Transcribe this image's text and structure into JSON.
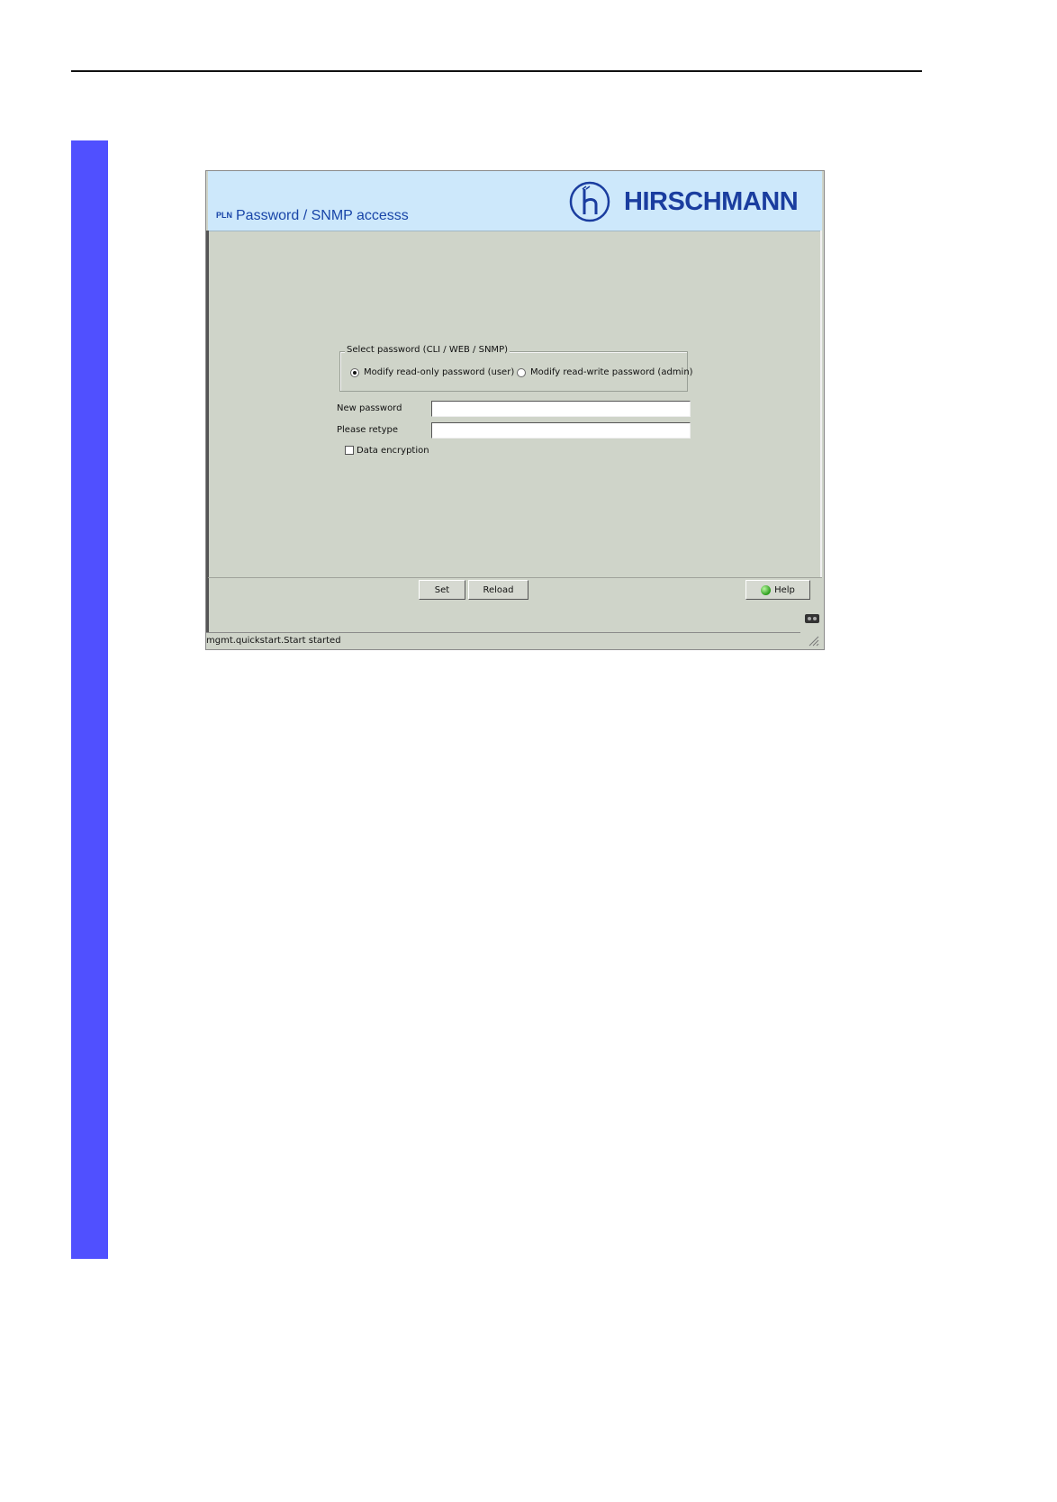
{
  "window": {
    "page_title": "Password / SNMP accesss",
    "title_mini_icon": "PLN",
    "brand_name": "HIRSCHMANN",
    "logo_icon": "hirschmann-h-logo-icon"
  },
  "form": {
    "group_legend": "Select password  (CLI / WEB / SNMP)",
    "radio_user_label": "Modify read-only password (user)",
    "radio_admin_label": "Modify read-write password (admin)",
    "selected_radio": "user",
    "new_password_label": "New password",
    "new_password_value": "",
    "retype_label": "Please retype",
    "retype_value": "",
    "encryption_label": "Data encryption",
    "encryption_checked": false
  },
  "buttons": {
    "set_label": "Set",
    "reload_label": "Reload",
    "help_label": "Help"
  },
  "status": {
    "text": "mgmt.quickstart.Start started"
  },
  "colors": {
    "side_bar": "#5050ff",
    "banner": "#cde8fb",
    "panel": "#cfd4c9",
    "brand": "#1a3d9f"
  }
}
